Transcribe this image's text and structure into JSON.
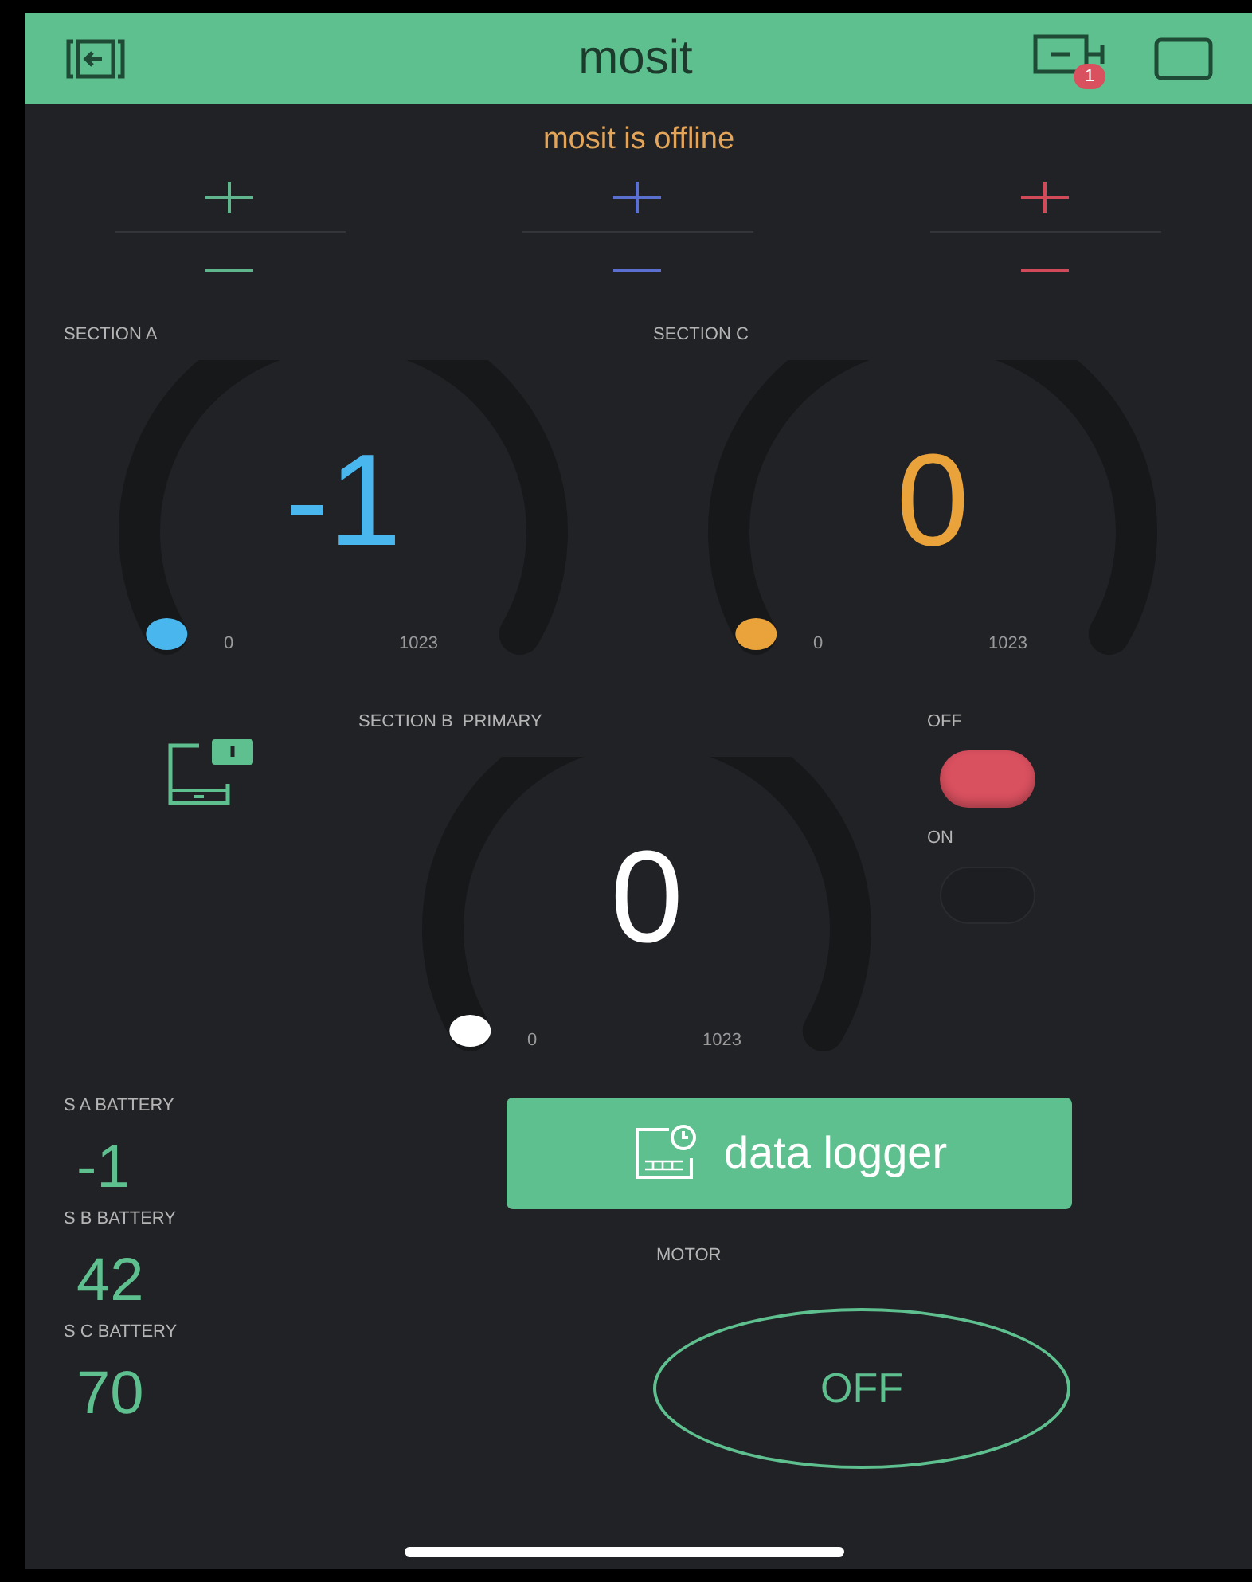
{
  "header": {
    "title": "mosit",
    "badge": "1"
  },
  "status": "mosit is offline",
  "steppers": [
    {
      "color": "#5fb58c"
    },
    {
      "color": "#5a6fd0"
    },
    {
      "color": "#d04a5a"
    }
  ],
  "gauges": [
    {
      "label": "SECTION A",
      "value": "-1",
      "min": "0",
      "max": "1023",
      "level": 0,
      "color": "#4ab6ee"
    },
    {
      "label": "SECTION C",
      "value": "0",
      "min": "0",
      "max": "1023",
      "level": 0,
      "color": "#eaa33a"
    },
    {
      "label": "SECTION B  PRIMARY",
      "value": "0",
      "min": "0",
      "max": "1023",
      "level": 0,
      "color": "#ffffff"
    }
  ],
  "leds": [
    {
      "label": "OFF",
      "on": true
    },
    {
      "label": "ON",
      "on": false
    }
  ],
  "batteries": [
    {
      "label": "S A BATTERY",
      "value": "-1"
    },
    {
      "label": "S B BATTERY",
      "value": "42"
    },
    {
      "label": "S C BATTERY",
      "value": "70"
    }
  ],
  "data_logger_button": "data logger",
  "motor": {
    "label": "MOTOR",
    "button": "OFF",
    "on": false
  }
}
